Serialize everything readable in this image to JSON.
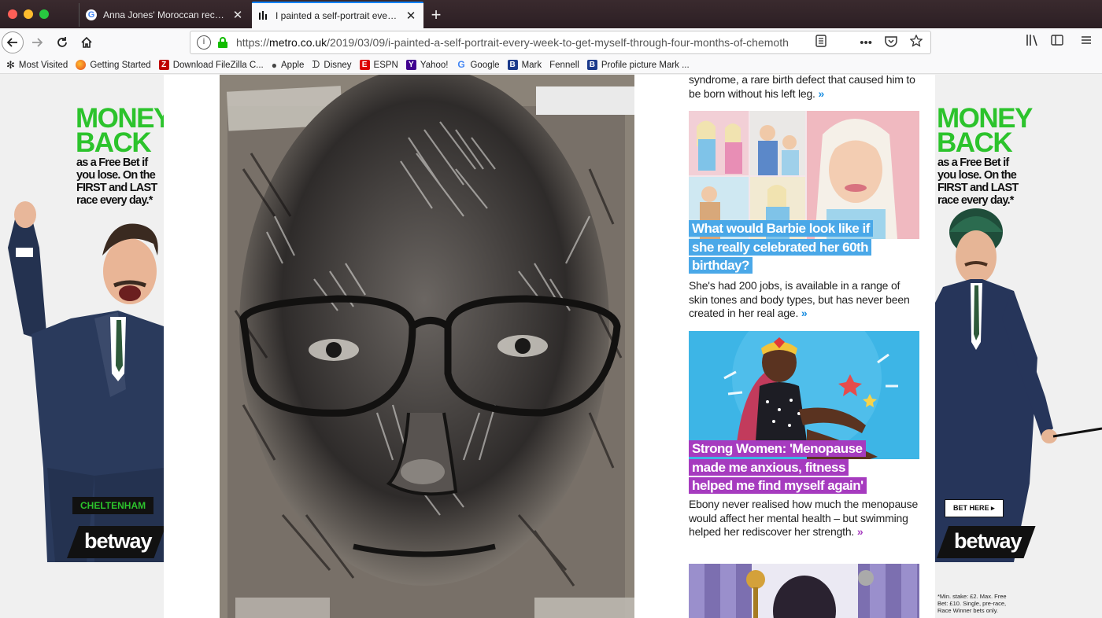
{
  "browser": {
    "tabs": [
      {
        "title": "Anna Jones' Moroccan recipes",
        "favicon": "G",
        "active": false
      },
      {
        "title": "I painted a self-portrait every w",
        "favicon": "metro-favicon",
        "active": true
      }
    ],
    "new_tab": "+",
    "url": {
      "scheme": "https://",
      "host": "metro.co.uk",
      "path": "/2019/03/09/i-painted-a-self-portrait-every-week-to-get-myself-through-four-months-of-chemoth"
    },
    "bookmarks": [
      {
        "label": "Most Visited",
        "icon": "gear-icon"
      },
      {
        "label": "Getting Started",
        "icon": "firefox-icon"
      },
      {
        "label": "Download FileZilla C...",
        "icon": "filezilla-icon"
      },
      {
        "label": "Apple",
        "icon": "apple-icon"
      },
      {
        "label": "Disney",
        "icon": "disney-icon"
      },
      {
        "label": "ESPN",
        "icon": "espn-icon"
      },
      {
        "label": "Yahoo!",
        "icon": "yahoo-icon"
      },
      {
        "label": "Google",
        "icon": "google-icon"
      },
      {
        "label": "Mark",
        "icon": "b-icon"
      },
      {
        "label": "Fennell",
        "icon": ""
      },
      {
        "label": "Profile picture Mark ...",
        "icon": "b-icon"
      }
    ]
  },
  "ads": {
    "left": {
      "headline_1": "MONEY",
      "headline_2": "BACK",
      "sub_1": "as a Free Bet if",
      "sub_2": "you lose. On the",
      "sub_3": "FIRST and LAST",
      "sub_4": "race every day.*",
      "tag": "CHELTENHAM",
      "brand": "betway"
    },
    "right": {
      "headline_1": "MONEY",
      "headline_2": "BACK",
      "sub_1": "as a Free Bet if",
      "sub_2": "you lose. On the",
      "sub_3": "FIRST and LAST",
      "sub_4": "race every day.*",
      "cta": "BET HERE ▸",
      "brand": "betway",
      "terms_1": "*Min. stake: £2. Max. Free",
      "terms_2": "Bet: £10. Single, pre-race,",
      "terms_3": "Race Winner bets only."
    }
  },
  "sidebar": {
    "intro_text": "syndrome, a rare birth defect that caused him to be born without his left leg.",
    "more_glyph": "»",
    "stories": [
      {
        "title_lines": [
          "What would Barbie look like if",
          "she really celebrated her 60th",
          "birthday?"
        ],
        "description": "She's had 200 jobs, is available in a range of skin tones and body types, but has never been created in her real age.",
        "accent": "#4aa8e8"
      },
      {
        "title_lines": [
          "Strong Women: 'Menopause",
          "made me anxious, fitness",
          "helped me find myself again'"
        ],
        "description": "Ebony never realised how much the menopause would affect her mental health – but swimming helped her rediscover her strength.",
        "accent": "#a63bbf"
      }
    ]
  },
  "colors": {
    "metro_blue": "#1a8de0",
    "betway_green": "#2cc32c",
    "barbie_blue": "#4aa8e8",
    "strong_purple": "#a63bbf"
  }
}
